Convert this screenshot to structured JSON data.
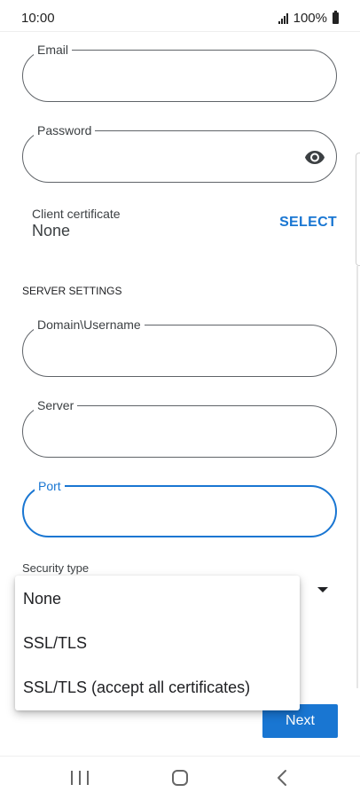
{
  "status_bar": {
    "time": "10:00",
    "battery": "100%"
  },
  "fields": {
    "email": {
      "label": "Email",
      "value": ""
    },
    "password": {
      "label": "Password",
      "value": ""
    },
    "domain_username": {
      "label": "Domain\\Username",
      "value": ""
    },
    "server": {
      "label": "Server",
      "value": ""
    },
    "port": {
      "label": "Port",
      "value": ""
    }
  },
  "client_certificate": {
    "label": "Client certificate",
    "value": "None",
    "select_label": "SELECT"
  },
  "server_settings": {
    "header": "SERVER SETTINGS"
  },
  "security_type": {
    "label": "Security type",
    "options": [
      "None",
      "SSL/TLS",
      "SSL/TLS (accept all certificates)"
    ]
  },
  "actions": {
    "next_label": "Next"
  },
  "icons": {
    "password_toggle": "eye-icon",
    "dropdown": "dropdown-arrow-icon",
    "nav_recents": "recents-icon",
    "nav_home": "home-icon",
    "nav_back": "back-icon"
  },
  "colors": {
    "accent": "#1976d2",
    "outline": "#5f6368"
  }
}
